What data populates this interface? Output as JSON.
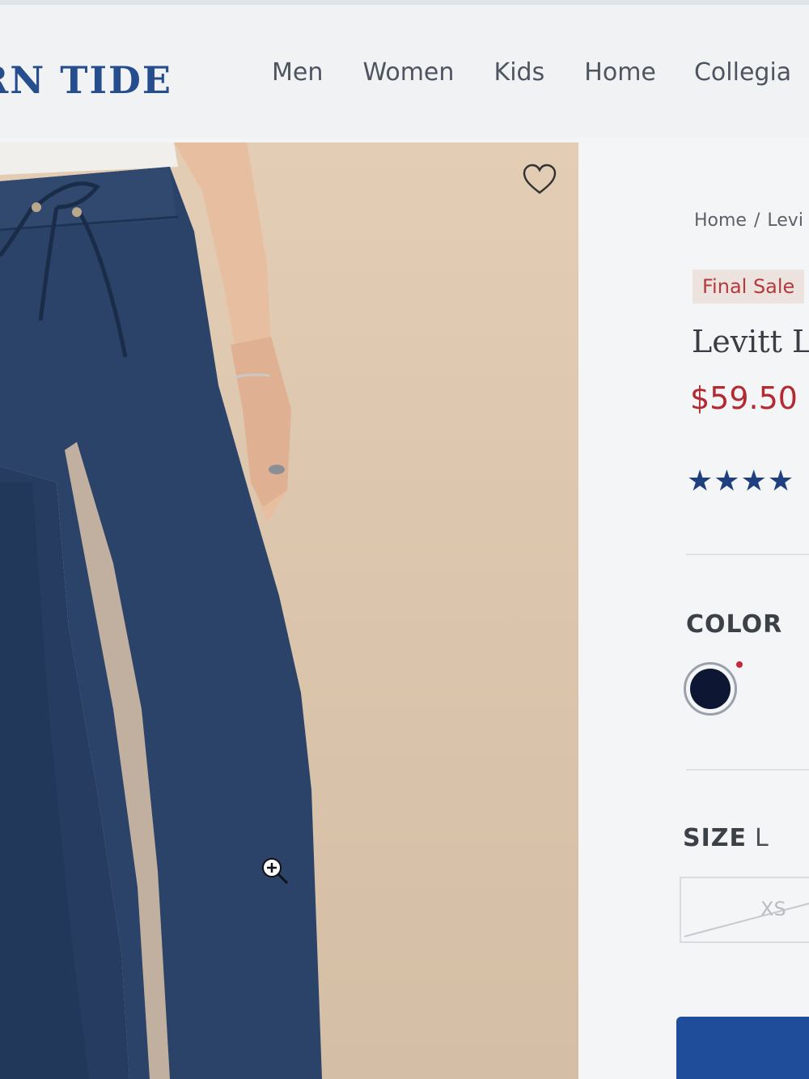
{
  "header": {
    "logo_text": "RN TIDE",
    "nav": [
      "Men",
      "Women",
      "Kids",
      "Home",
      "Collegia"
    ]
  },
  "product_image": {
    "wishlist_icon": "heart-outline-icon",
    "zoom_icon": "zoom-in-cursor-icon"
  },
  "product": {
    "breadcrumb": {
      "home": "Home",
      "separator": "/",
      "current": "Levi"
    },
    "badge": "Final Sale",
    "title": "Levitt L",
    "price": "$59.50",
    "rating_stars_visible": 4,
    "color": {
      "label": "COLOR",
      "swatch_color": "#0d1633",
      "indicator_color": "#c9283a"
    },
    "size": {
      "label": "SIZE",
      "selected": "L",
      "options": [
        {
          "label": "XS",
          "available": false
        }
      ]
    },
    "add_button_color": "#1f4d9a"
  },
  "colors": {
    "brand_blue": "#264e8f",
    "sale_red": "#b42a32",
    "star_navy": "#1f3f7f"
  }
}
